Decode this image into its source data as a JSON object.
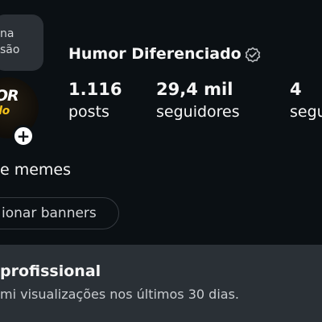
{
  "tooltip": {
    "line1": "na",
    "line2": "são"
  },
  "avatar": {
    "logo_top": "MOR",
    "logo_bottom": "ciado"
  },
  "add_badge": "+",
  "profile": {
    "username": "Humor Diferenciado"
  },
  "stats": {
    "posts": {
      "count": "1.116",
      "label": "posts"
    },
    "followers": {
      "count": "29,4 mil",
      "label": "seguidores"
    },
    "following": {
      "count": "4",
      "label": "segu"
    }
  },
  "bio": "e memes",
  "buttons": {
    "banners": "ionar banners"
  },
  "dashboard": {
    "title": "profissional",
    "subtitle": "mi visualizações nos últimos 30 dias."
  },
  "colors": {
    "background": "#0b1014",
    "panel": "#2a3036",
    "logo_yellow": "#f4c21b"
  },
  "icons": [
    "verified-badge-icon",
    "plus-icon"
  ]
}
